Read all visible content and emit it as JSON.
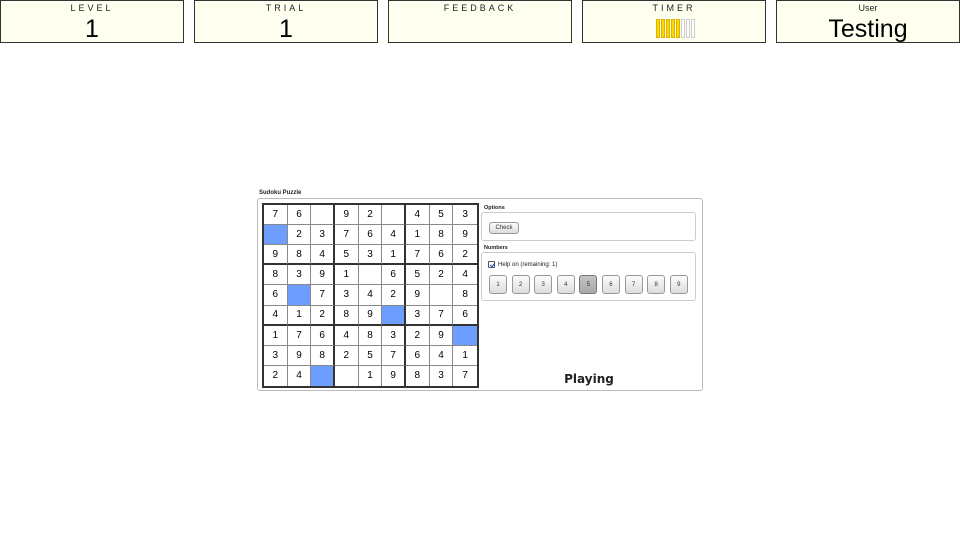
{
  "header": {
    "level": {
      "title": "LEVEL",
      "value": "1"
    },
    "trial": {
      "title": "TRIAL",
      "value": "1"
    },
    "feedback": {
      "title": "FEEDBACK",
      "value": ""
    },
    "timer": {
      "title": "TIMER",
      "segments_total": 8,
      "segments_filled": 5,
      "fill_color": "#ffd600"
    },
    "user": {
      "title": "User",
      "value": "Testing"
    }
  },
  "puzzle": {
    "caption": "Sudoku Puzzle",
    "highlight_color": "#6d9eff",
    "grid": [
      [
        "7",
        "6",
        "",
        "9",
        "2",
        "",
        "4",
        "5",
        "3"
      ],
      [
        "",
        "2",
        "3",
        "7",
        "6",
        "4",
        "1",
        "8",
        "9"
      ],
      [
        "9",
        "8",
        "4",
        "5",
        "3",
        "1",
        "7",
        "6",
        "2"
      ],
      [
        "8",
        "3",
        "9",
        "1",
        "",
        "6",
        "5",
        "2",
        "4"
      ],
      [
        "6",
        "",
        "7",
        "3",
        "4",
        "2",
        "9",
        "",
        "8"
      ],
      [
        "4",
        "1",
        "2",
        "8",
        "9",
        "",
        "3",
        "7",
        "6"
      ],
      [
        "1",
        "7",
        "6",
        "4",
        "8",
        "3",
        "2",
        "9",
        ""
      ],
      [
        "3",
        "9",
        "8",
        "2",
        "5",
        "7",
        "6",
        "4",
        "1"
      ],
      [
        "2",
        "4",
        "",
        "",
        "1",
        "9",
        "8",
        "3",
        "7"
      ]
    ],
    "highlighted_cells": [
      [
        1,
        0
      ],
      [
        4,
        1
      ],
      [
        5,
        5
      ],
      [
        6,
        8
      ],
      [
        8,
        2
      ]
    ],
    "options": {
      "label": "Options",
      "check_button": "Check"
    },
    "numbers": {
      "label": "Numbers",
      "help_text": "Help on (remaining: 1)",
      "help_checked": true,
      "buttons": [
        "1",
        "2",
        "3",
        "4",
        "5",
        "6",
        "7",
        "8",
        "9"
      ],
      "selected": "5"
    },
    "state": "Playing"
  }
}
